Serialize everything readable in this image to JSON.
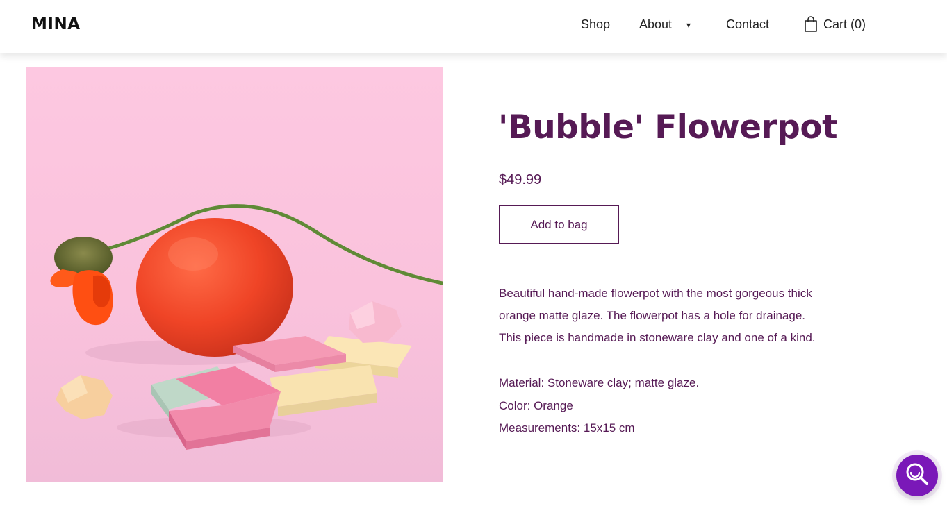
{
  "header": {
    "logo": "MINA",
    "nav": {
      "shop": "Shop",
      "about": "About",
      "about_caret": "▾",
      "contact": "Contact",
      "cart": "Cart (0)"
    }
  },
  "product": {
    "title": "'Bubble' Flowerpot",
    "price": "$49.99",
    "add_to_bag": "Add to bag",
    "description": [
      "Beautiful hand-made flowerpot with the most gorgeous thick",
      "orange matte glaze. The flowerpot has a hole for drainage.",
      "This piece is handmade in stoneware clay and one of a kind."
    ],
    "specs": [
      "Material: Stoneware clay; matte glaze.",
      "Color: Orange",
      "Measurements: 15x15 cm"
    ]
  },
  "colors": {
    "accent": "#561a55",
    "fab": "#7a18b8",
    "hero_background": "#fdc7df",
    "flowerpot": "#f0452a"
  },
  "icons": {
    "cart": "shopping-bag-icon",
    "search": "search-icon",
    "caret": "chevron-down-icon"
  }
}
